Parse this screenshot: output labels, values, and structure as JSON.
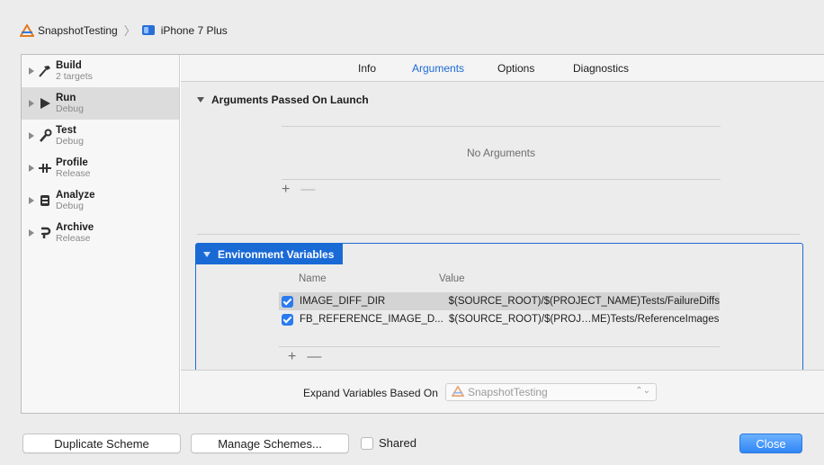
{
  "breadcrumb": {
    "project": "SnapshotTesting",
    "destination": "iPhone 7 Plus"
  },
  "sidebar": {
    "items": [
      {
        "title": "Build",
        "subtitle": "2 targets",
        "icon": "hammer-icon"
      },
      {
        "title": "Run",
        "subtitle": "Debug",
        "icon": "play-icon"
      },
      {
        "title": "Test",
        "subtitle": "Debug",
        "icon": "wrench-icon"
      },
      {
        "title": "Profile",
        "subtitle": "Release",
        "icon": "instruments-icon"
      },
      {
        "title": "Analyze",
        "subtitle": "Debug",
        "icon": "analyze-icon"
      },
      {
        "title": "Archive",
        "subtitle": "Release",
        "icon": "archive-icon"
      }
    ],
    "selected_index": 1
  },
  "tabs": [
    {
      "label": "Info"
    },
    {
      "label": "Arguments"
    },
    {
      "label": "Options"
    },
    {
      "label": "Diagnostics"
    }
  ],
  "active_tab": "Arguments",
  "arguments": {
    "title": "Arguments Passed On Launch",
    "empty_text": "No Arguments",
    "add": "+",
    "remove": "—"
  },
  "environment": {
    "title": "Environment Variables",
    "col_name": "Name",
    "col_value": "Value",
    "rows": [
      {
        "name": "IMAGE_DIFF_DIR",
        "value": "$(SOURCE_ROOT)/$(PROJECT_NAME)Tests/FailureDiffs",
        "checked": true
      },
      {
        "name": "FB_REFERENCE_IMAGE_D...",
        "value": "$(SOURCE_ROOT)/$(PROJ…ME)Tests/ReferenceImages",
        "checked": true
      }
    ],
    "selected_row": 0,
    "add": "+",
    "remove": "—"
  },
  "expand": {
    "label": "Expand Variables Based On",
    "value": "SnapshotTesting"
  },
  "footer": {
    "duplicate": "Duplicate Scheme",
    "manage": "Manage Schemes...",
    "shared": "Shared",
    "close": "Close"
  },
  "colors": {
    "accent": "#1a6ad6",
    "selection": "#dcdcdc"
  }
}
